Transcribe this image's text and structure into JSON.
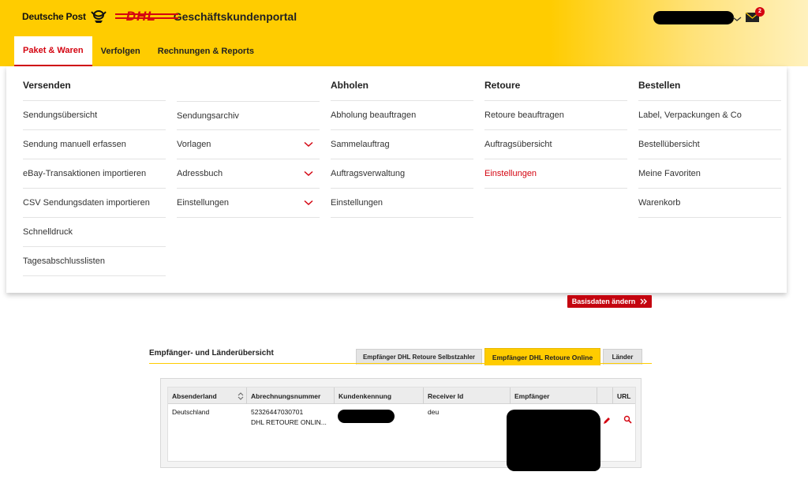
{
  "header": {
    "brand_text": "Deutsche Post",
    "dhl_logo_text": "DHL",
    "portal_title": "Geschäftskundenportal",
    "mail_badge_count": "2",
    "brand_color": "#ffcc00",
    "accent_color": "#d40511"
  },
  "nav": {
    "tabs": [
      {
        "label": "Paket & Waren"
      },
      {
        "label": "Verfolgen"
      },
      {
        "label": "Rechnungen & Reports"
      }
    ]
  },
  "mega_menu": {
    "columns": [
      {
        "heading": "Versenden",
        "items": [
          "Sendungsübersicht",
          "Sendung manuell erfassen",
          "eBay-Transaktionen importieren",
          "CSV Sendungsdaten importieren",
          "Schnelldruck",
          "Tagesabschlusslisten"
        ]
      },
      {
        "heading": "",
        "items": [
          "Sendungsarchiv",
          "Vorlagen",
          "Adressbuch",
          "Einstellungen"
        ]
      },
      {
        "heading": "Abholen",
        "items": [
          "Abholung beauftragen",
          "Sammelauftrag",
          "Auftragsverwaltung",
          "Einstellungen"
        ]
      },
      {
        "heading": "Retoure",
        "items": [
          "Retoure beauftragen",
          "Auftragsübersicht",
          "Einstellungen"
        ]
      },
      {
        "heading": "Bestellen",
        "items": [
          "Label, Verpackungen & Co",
          "Bestellübersicht",
          "Meine Favoriten",
          "Warenkorb"
        ]
      }
    ]
  },
  "basisdaten_button": {
    "label": "Basisdaten ändern"
  },
  "overview": {
    "title": "Empfänger- und Länderübersicht",
    "tabs": [
      {
        "label": "Empfänger DHL Retoure Selbstzahler"
      },
      {
        "label": "Empfänger DHL Retoure Online"
      },
      {
        "label": "Länder"
      }
    ],
    "table": {
      "columns": [
        "Absenderland",
        "Abrechnungsnummer",
        "Kundenkennung",
        "Receiver Id",
        "Empfänger",
        "",
        "URL"
      ],
      "rows": [
        {
          "absenderland": "Deutschland",
          "abrechnungsnummer": "52326447030701",
          "abrechnungsname": "DHL RETOURE ONLIN...",
          "receiver_id": "deu"
        }
      ]
    }
  }
}
